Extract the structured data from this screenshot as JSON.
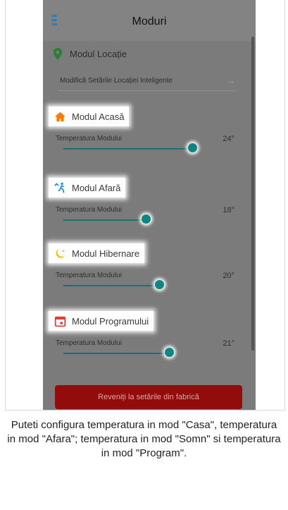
{
  "app": {
    "title": "Moduri",
    "menu_icon": "hamburger-menu-icon",
    "location": {
      "label": "Modul Locație",
      "link": "Modifică Setările Locației Inteligente",
      "icon": "location-pin-icon",
      "icon_color": "#2e7d32"
    },
    "modes": [
      {
        "name": "Modul Acasă",
        "icon": "home-icon",
        "icon_color": "#f57c00",
        "temp_label": "Temperatura Modului",
        "temp_value": "24°",
        "slider_level": 0.83
      },
      {
        "name": "Modul Afară",
        "icon": "walking-person-icon",
        "icon_color": "#1e88e5",
        "temp_label": "Temperatura Modului",
        "temp_value": "18°",
        "slider_level": 0.53
      },
      {
        "name": "Modul Hibernare",
        "icon": "moon-icon",
        "icon_color": "#fbc02d",
        "temp_label": "Temperatura Modului",
        "temp_value": "20°",
        "slider_level": 0.62
      },
      {
        "name": "Modul Programului",
        "icon": "calendar-icon",
        "icon_color": "#e53935",
        "temp_label": "Temperatura Modului",
        "temp_value": "21°",
        "slider_level": 0.68
      }
    ],
    "reset_button": "Reveniți la setările din fabrică"
  },
  "caption": "Puteti configura temperatura in mod \"Casa\", temperatura in mod \"Afara\"; temperatura in mod \"Somn\" si temperatura in mod \"Program\"."
}
